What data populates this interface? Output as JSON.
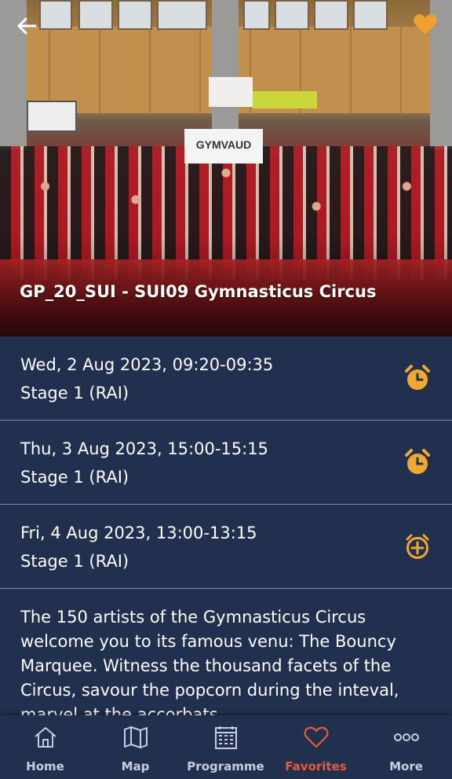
{
  "event": {
    "title": "GP_20_SUI - SUI09 Gymnasticus Circus",
    "photo_banner_text": "GYMVAUD",
    "is_favorite": true
  },
  "sessions": [
    {
      "date_time": "Wed, 2 Aug 2023, 09:20-09:35",
      "stage": "Stage 1 (RAI)",
      "icon": "alarm-clock-icon"
    },
    {
      "date_time": "Thu, 3 Aug 2023, 15:00-15:15",
      "stage": "Stage 1 (RAI)",
      "icon": "alarm-clock-icon"
    },
    {
      "date_time": "Fri, 4 Aug 2023, 13:00-13:15",
      "stage": "Stage 1 (RAI)",
      "icon": "add-circle-icon"
    }
  ],
  "description": "The 150 artists of the Gymnasticus Circus welcome you to its famous venu: The Bouncy Marquee. Witness the thousand facets of the Circus, savour the popcorn during the inteval, marvel at the accorbats",
  "nav": {
    "items": [
      {
        "label": "Home",
        "icon": "home-icon",
        "active": false
      },
      {
        "label": "Map",
        "icon": "map-icon",
        "active": false
      },
      {
        "label": "Programme",
        "icon": "calendar-icon",
        "active": false
      },
      {
        "label": "Favorites",
        "icon": "heart-icon",
        "active": true
      },
      {
        "label": "More",
        "icon": "more-dots-icon",
        "active": false
      }
    ]
  },
  "colors": {
    "background": "#22304f",
    "accent_orange": "#f0a830",
    "active_nav": "#e85a3a",
    "divider": "#7e8aa4"
  }
}
